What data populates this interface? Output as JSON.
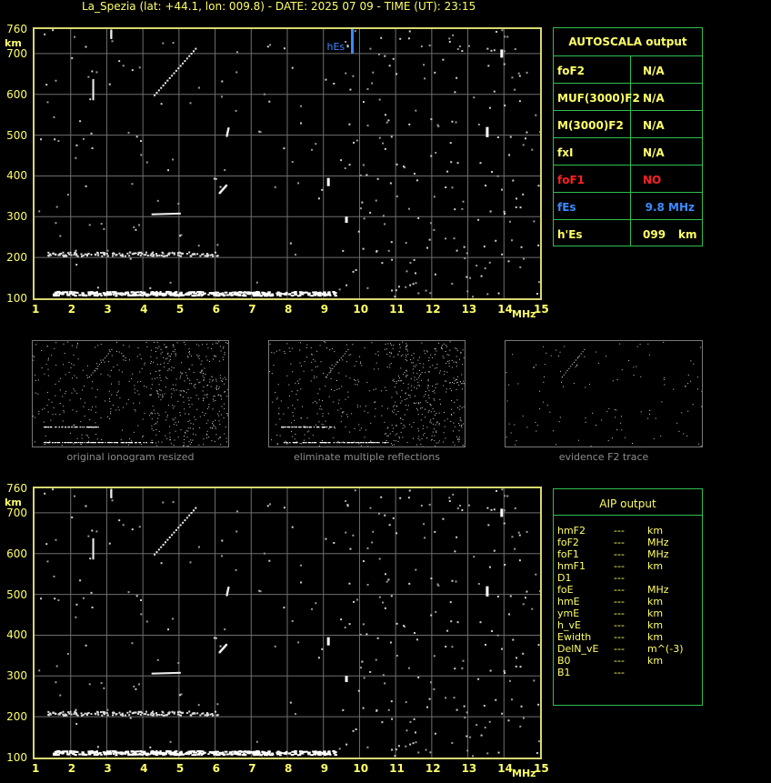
{
  "header": "La_Spezia (lat: +44.1, lon: 009.8) - DATE: 2025 07 09 - TIME (UT): 23:15",
  "chart_data": [
    {
      "type": "scatter",
      "ylabel": "km",
      "xlabel": "MHz",
      "xlim": [
        1,
        15
      ],
      "ylim": [
        100,
        760
      ],
      "xticks": [
        "1",
        "2",
        "3",
        "4",
        "5",
        "6",
        "7",
        "8",
        "9",
        "10",
        "11",
        "12",
        "13",
        "14",
        "15"
      ],
      "yticks": [
        "760",
        "700",
        "600",
        "500",
        "400",
        "300",
        "200",
        "100"
      ],
      "grid": true,
      "marker_label": "hEs",
      "marker_x": 9.8
    },
    {
      "type": "scatter",
      "ylabel": "km",
      "xlabel": "MHz",
      "xlim": [
        1,
        15
      ],
      "ylim": [
        100,
        760
      ],
      "xticks": [
        "1",
        "2",
        "3",
        "4",
        "5",
        "6",
        "7",
        "8",
        "9",
        "10",
        "11",
        "12",
        "13",
        "14",
        "15"
      ],
      "yticks": [
        "760",
        "700",
        "600",
        "500",
        "400",
        "300",
        "200",
        "100"
      ],
      "grid": true
    }
  ],
  "autoscala": {
    "title": "AUTOSCALA output",
    "rows": [
      {
        "label": "foF2",
        "value": "N/A",
        "color": "#ffff66"
      },
      {
        "label": "MUF(3000)F2",
        "value": "N/A",
        "color": "#ffff66"
      },
      {
        "label": "M(3000)F2",
        "value": "N/A",
        "color": "#ffff66"
      },
      {
        "label": "fxI",
        "value": "N/A",
        "color": "#ffff66"
      },
      {
        "label": "foF1",
        "value": "NO",
        "color": "#ff2020"
      },
      {
        "label": "fEs",
        "value": "9.8 MHz",
        "color": "#3b8bff"
      },
      {
        "label": "h'Es",
        "value": "099",
        "unit": "km",
        "color": "#ffff66"
      }
    ]
  },
  "thumbnails": [
    {
      "caption": "original ionogram resized"
    },
    {
      "caption": "eliminate multiple reflections"
    },
    {
      "caption": "evidence F2 trace"
    }
  ],
  "aip": {
    "title": "AIP output",
    "rows": [
      {
        "label": "hmF2",
        "value": "---",
        "unit": "km"
      },
      {
        "label": "foF2",
        "value": "---",
        "unit": "MHz"
      },
      {
        "label": "foF1",
        "value": "---",
        "unit": "MHz"
      },
      {
        "label": "hmF1",
        "value": "---",
        "unit": "km"
      },
      {
        "label": "D1",
        "value": "---",
        "unit": ""
      },
      {
        "label": "foE",
        "value": "---",
        "unit": "MHz"
      },
      {
        "label": "hmE",
        "value": "---",
        "unit": "km"
      },
      {
        "label": "ymE",
        "value": "---",
        "unit": "km"
      },
      {
        "label": "h_vE",
        "value": "---",
        "unit": "km"
      },
      {
        "label": "Ewidth",
        "value": "---",
        "unit": "km"
      },
      {
        "label": "DelN_vE",
        "value": "---",
        "unit": "m^(-3)"
      },
      {
        "label": "B0",
        "value": "---",
        "unit": "km"
      },
      {
        "label": "B1",
        "value": "---",
        "unit": ""
      }
    ]
  }
}
